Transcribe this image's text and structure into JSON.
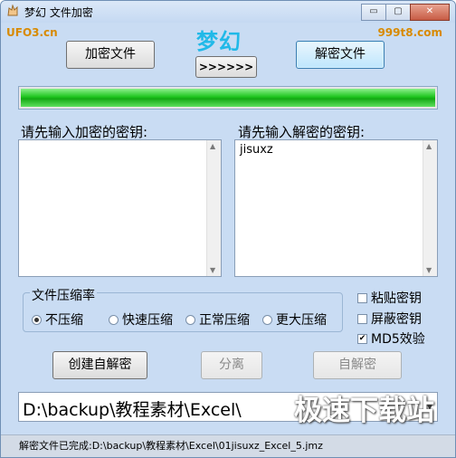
{
  "window": {
    "title": "梦幻 文件加密",
    "minimize": "▭",
    "maximize": "▢",
    "close": "✕"
  },
  "branding": {
    "left_logo": "UFO3.cn",
    "center": "梦幻",
    "right_logo": "999t8.com"
  },
  "toolbar": {
    "encrypt_file": "加密文件",
    "arrows": ">>>>>>",
    "decrypt_file": "解密文件"
  },
  "progress": {
    "fraction": 1.0
  },
  "keys": {
    "encrypt_label": "请先输入加密的密钥:",
    "encrypt_value": "",
    "decrypt_label": "请先输入解密的密钥:",
    "decrypt_value": "jisuxz"
  },
  "compression": {
    "title": "文件压缩率",
    "options": [
      "不压缩",
      "快速压缩",
      "正常压缩",
      "更大压缩"
    ],
    "selected": "不压缩"
  },
  "checks": [
    {
      "label": "粘贴密钥",
      "checked": false
    },
    {
      "label": "屏蔽密钥",
      "checked": false
    },
    {
      "label": "MD5效验",
      "checked": true
    }
  ],
  "actions": {
    "create_self_decrypt": "创建自解密",
    "separate": "分离",
    "self_decrypt": "自解密"
  },
  "path": {
    "value": "D:\\backup\\教程素材\\Excel\\"
  },
  "watermark": "极速下载站",
  "status": "解密文件已完成:D:\\backup\\教程素材\\Excel\\01jisuxz_Excel_5.jmz",
  "colors": {
    "brand_blue": "#21b9e8",
    "logo_orange": "#d88a00",
    "progress_green": "#1fc51f"
  }
}
